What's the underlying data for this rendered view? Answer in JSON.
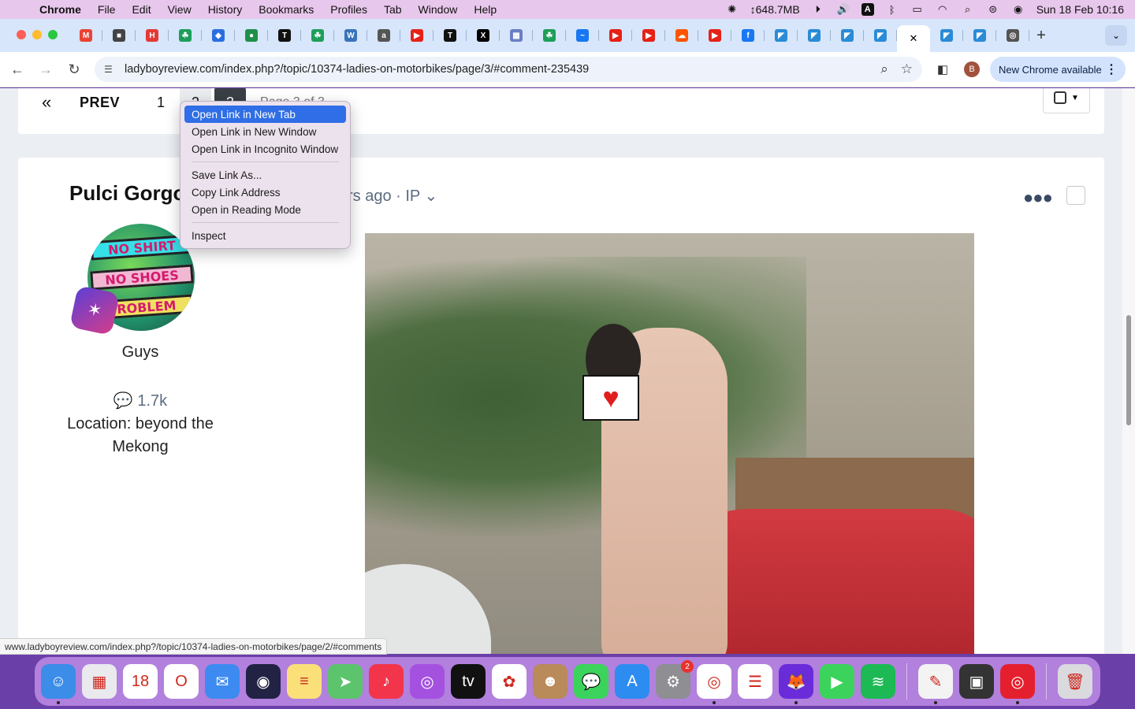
{
  "menubar": {
    "app_name": "Chrome",
    "items": [
      "File",
      "Edit",
      "View",
      "History",
      "Bookmarks",
      "Profiles",
      "Tab",
      "Window",
      "Help"
    ],
    "memory": "↕648.7MB",
    "datetime": "Sun 18 Feb  10:16"
  },
  "tabs": [
    {
      "icon": "gmail-icon",
      "color": "#ea4335",
      "glyph": "M"
    },
    {
      "icon": "cube-icon",
      "color": "#444444",
      "glyph": "■"
    },
    {
      "icon": "h-logo-icon",
      "color": "#e53935",
      "glyph": "H"
    },
    {
      "icon": "green-leaf-icon",
      "color": "#1e9e5a",
      "glyph": "☘"
    },
    {
      "icon": "blue-diamond-icon",
      "color": "#2a6de0",
      "glyph": "◆"
    },
    {
      "icon": "globe-green-icon",
      "color": "#1f8f4a",
      "glyph": "●"
    },
    {
      "icon": "nyt-icon",
      "color": "#111111",
      "glyph": "T"
    },
    {
      "icon": "green-leaf-icon",
      "color": "#1e9e5a",
      "glyph": "☘"
    },
    {
      "icon": "wordpress-icon",
      "color": "#3b73b9",
      "glyph": "W"
    },
    {
      "icon": "amazon-icon",
      "color": "#555555",
      "glyph": "a"
    },
    {
      "icon": "youtube-icon",
      "color": "#e62117",
      "glyph": "▶"
    },
    {
      "icon": "nyt-icon",
      "color": "#111111",
      "glyph": "T"
    },
    {
      "icon": "x-icon",
      "color": "#000000",
      "glyph": "X"
    },
    {
      "icon": "grid-icon",
      "color": "#6a7fc4",
      "glyph": "▦"
    },
    {
      "icon": "green-leaf-icon",
      "color": "#1e9e5a",
      "glyph": "☘"
    },
    {
      "icon": "messenger-icon",
      "color": "#1877f2",
      "glyph": "~"
    },
    {
      "icon": "youtube-icon",
      "color": "#e62117",
      "glyph": "▶"
    },
    {
      "icon": "youtube-icon",
      "color": "#e62117",
      "glyph": "▶"
    },
    {
      "icon": "soundcloud-icon",
      "color": "#ff5500",
      "glyph": "☁"
    },
    {
      "icon": "youtube-icon",
      "color": "#e62117",
      "glyph": "▶"
    },
    {
      "icon": "facebook-icon",
      "color": "#1877f2",
      "glyph": "f"
    },
    {
      "icon": "lbr-icon",
      "color": "#2a8bd6",
      "glyph": "◤"
    },
    {
      "icon": "lbr-icon",
      "color": "#2a8bd6",
      "glyph": "◤"
    },
    {
      "icon": "lbr-icon",
      "color": "#2a8bd6",
      "glyph": "◤"
    },
    {
      "icon": "lbr-icon",
      "color": "#2a8bd6",
      "glyph": "◤"
    }
  ],
  "tabs_after": [
    {
      "icon": "lbr-icon",
      "color": "#2a8bd6",
      "glyph": "◤"
    },
    {
      "icon": "lbr-icon",
      "color": "#2a8bd6",
      "glyph": "◤"
    },
    {
      "icon": "chrome-icon",
      "color": "#555555",
      "glyph": "◎"
    }
  ],
  "toolbar": {
    "url": "ladyboyreview.com/index.php?/topic/10374-ladies-on-motorbikes/page/3/#comment-235439",
    "profile_initial": "B",
    "update_label": "New Chrome available"
  },
  "pager": {
    "first": "«",
    "prev": "PREV",
    "page1": "1",
    "page2": "2",
    "page3": "3",
    "page_label": "Page 3 of 3"
  },
  "post": {
    "author": "Pulci Gorgo",
    "meta": "rs ago · IP ⌄",
    "avatar_lines": [
      "NO SHIRT",
      "NO SHOES",
      "PROBLEM"
    ],
    "group": "Guys",
    "post_count": "1.7k",
    "location": "Location: beyond the Mekong"
  },
  "context_menu": {
    "items_group1": [
      "Open Link in New Tab",
      "Open Link in New Window",
      "Open Link in Incognito Window"
    ],
    "items_group2": [
      "Save Link As...",
      "Copy Link Address",
      "Open in Reading Mode"
    ],
    "items_group3": [
      "Inspect"
    ],
    "highlighted": "Open Link in New Tab"
  },
  "status_url": "www.ladyboyreview.com/index.php?/topic/10374-ladies-on-motorbikes/page/2/#comments",
  "dock": {
    "apps": [
      {
        "name": "finder",
        "color": "#3b8de8",
        "glyph": "☺",
        "running": true
      },
      {
        "name": "launchpad",
        "color": "#e9e9ee",
        "glyph": "▦",
        "running": false
      },
      {
        "name": "calendar",
        "color": "#ffffff",
        "glyph": "18",
        "running": false
      },
      {
        "name": "opera",
        "color": "#ffffff",
        "glyph": "O",
        "running": false
      },
      {
        "name": "mail",
        "color": "#3d8bf0",
        "glyph": "✉",
        "running": false
      },
      {
        "name": "siri",
        "color": "#222244",
        "glyph": "◉",
        "running": false
      },
      {
        "name": "notes",
        "color": "#fbe07a",
        "glyph": "≡",
        "running": false
      },
      {
        "name": "maps",
        "color": "#5cc46d",
        "glyph": "➤",
        "running": false
      },
      {
        "name": "music",
        "color": "#f2354a",
        "glyph": "♪",
        "running": false
      },
      {
        "name": "podcasts",
        "color": "#a451e0",
        "glyph": "◎",
        "running": false
      },
      {
        "name": "apple-tv",
        "color": "#111111",
        "glyph": "tv",
        "running": false
      },
      {
        "name": "photos",
        "color": "#ffffff",
        "glyph": "✿",
        "running": false
      },
      {
        "name": "contacts",
        "color": "#b98a5a",
        "glyph": "☻",
        "running": false
      },
      {
        "name": "messages",
        "color": "#3bd35b",
        "glyph": "💬",
        "running": false
      },
      {
        "name": "app-store",
        "color": "#2d8cf0",
        "glyph": "A",
        "running": false
      },
      {
        "name": "system-settings",
        "color": "#8e8e93",
        "glyph": "⚙",
        "running": false,
        "badge": "2"
      },
      {
        "name": "chrome",
        "color": "#ffffff",
        "glyph": "◎",
        "running": true
      },
      {
        "name": "reminders",
        "color": "#ffffff",
        "glyph": "☰",
        "running": false
      },
      {
        "name": "firefox",
        "color": "#6a2bd9",
        "glyph": "🦊",
        "running": true
      },
      {
        "name": "facetime",
        "color": "#3bd35b",
        "glyph": "▶",
        "running": false
      },
      {
        "name": "spotify",
        "color": "#1db954",
        "glyph": "≋",
        "running": false
      }
    ],
    "apps_after": [
      {
        "name": "textedit",
        "color": "#f3f3f3",
        "glyph": "✎",
        "running": true
      },
      {
        "name": "screen-capture",
        "color": "#333333",
        "glyph": "▣",
        "running": false
      },
      {
        "name": "target-app",
        "color": "#e5202e",
        "glyph": "◎",
        "running": true
      }
    ],
    "trash": {
      "name": "trash",
      "color": "#d9d9de",
      "glyph": "🗑"
    }
  }
}
